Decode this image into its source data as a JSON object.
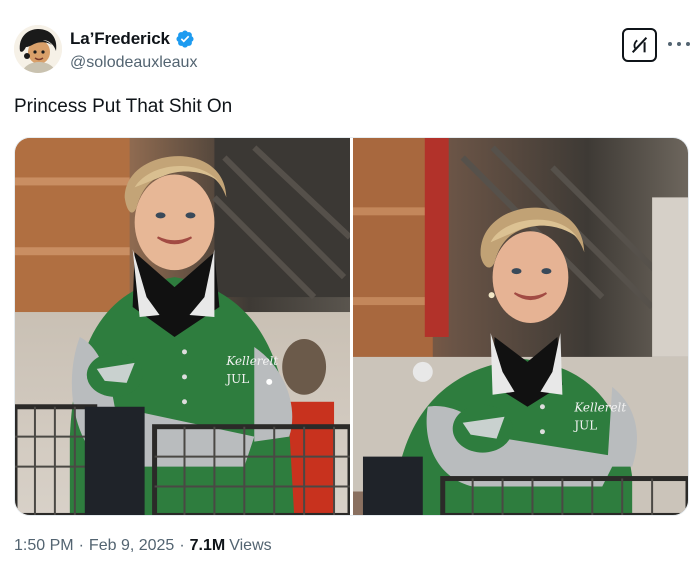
{
  "author": {
    "display_name": "La’Frederick",
    "handle": "@solodeauxleaux",
    "verified": true,
    "avatar_icon": "cartoon-avatar-icon"
  },
  "header_actions": {
    "grok_icon": "grok-icon",
    "more_icon": "more-dots-icon"
  },
  "tweet": {
    "text": "Princess Put That Shit On",
    "media_count": 2,
    "jacket_lettering": [
      "Kellerelt",
      "JUL"
    ]
  },
  "meta": {
    "time": "1:50 PM",
    "separator": "·",
    "date": "Feb 9, 2025",
    "views_count": "7.1M",
    "views_label": "Views"
  },
  "colors": {
    "text_primary": "#0f1419",
    "text_secondary": "#536471",
    "verified_blue": "#1d9bf0",
    "jacket_green": "#2e7d3e"
  }
}
